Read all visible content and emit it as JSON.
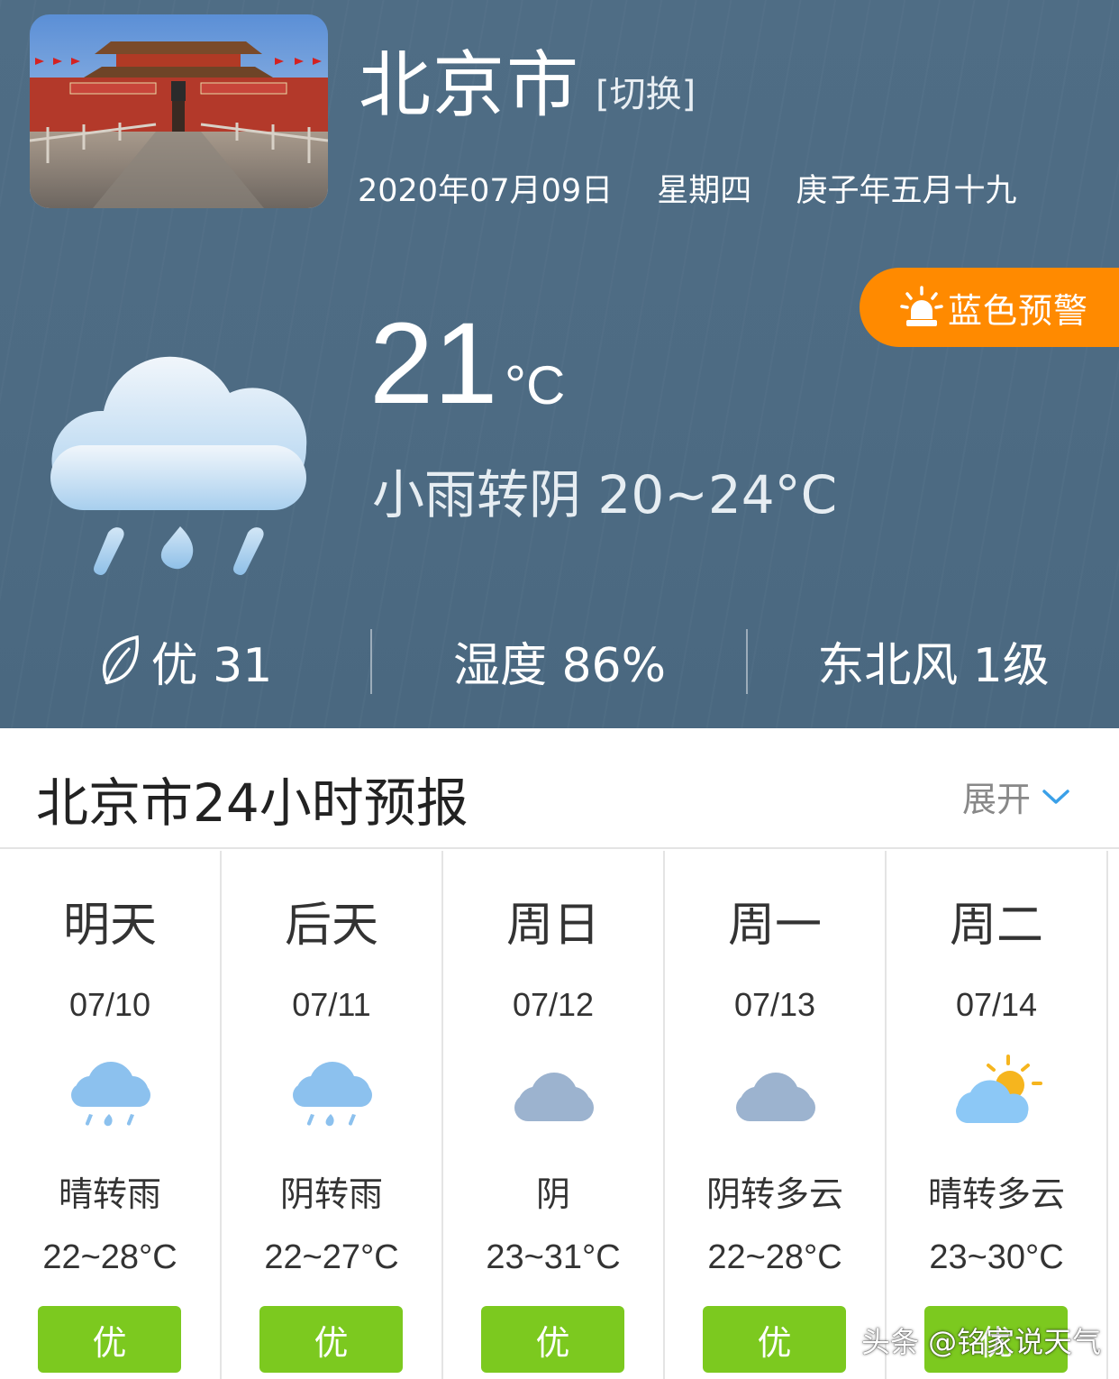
{
  "header": {
    "city": "北京市",
    "switch_label": "[切换]",
    "date": "2020年07月09日",
    "weekday": "星期四",
    "lunar_date": "庚子年五月十九",
    "alert_label": "蓝色预警",
    "alert_color": "#ff8a00",
    "current_temp": "21",
    "temp_unit": "°C",
    "condition_range": "小雨转阴 20~24°C",
    "weather_icon": "rain-cloud-icon",
    "aqi": "优 31",
    "humidity": "湿度 86%",
    "wind": "东北风 1级"
  },
  "forecast_section": {
    "title": "北京市24小时预报",
    "expand_label": "展开"
  },
  "days": [
    {
      "name": "明天",
      "date": "07/10",
      "icon": "rain-cloud-icon",
      "condition": "晴转雨",
      "range": "22~28°C",
      "aqi": "优"
    },
    {
      "name": "后天",
      "date": "07/11",
      "icon": "rain-cloud-icon",
      "condition": "阴转雨",
      "range": "22~27°C",
      "aqi": "优"
    },
    {
      "name": "周日",
      "date": "07/12",
      "icon": "cloud-icon",
      "condition": "阴",
      "range": "23~31°C",
      "aqi": "优"
    },
    {
      "name": "周一",
      "date": "07/13",
      "icon": "cloud-icon",
      "condition": "阴转多云",
      "range": "22~28°C",
      "aqi": "优"
    },
    {
      "name": "周二",
      "date": "07/14",
      "icon": "sun-cloud-icon",
      "condition": "晴转多云",
      "range": "23~30°C",
      "aqi": "优"
    }
  ],
  "aqi_good_color": "#7cc91f",
  "watermark": "头条 @铭家说天气"
}
